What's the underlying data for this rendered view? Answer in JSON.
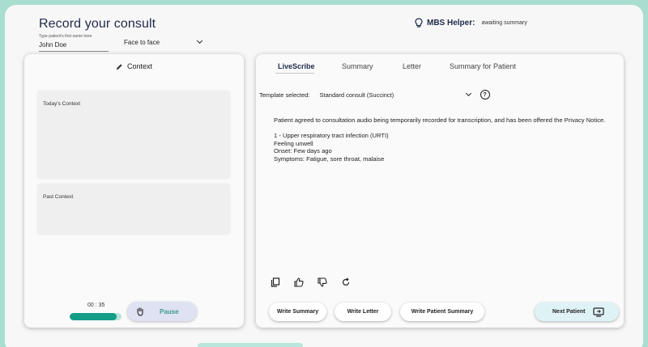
{
  "header": {
    "title": "Record your consult",
    "patient_label": "Type patient's first name here",
    "patient_name": "John Doe",
    "consult_mode": "Face to face"
  },
  "mbs": {
    "label": "MBS Helper:",
    "status": "awaiting summary",
    "icon": "lightbulb-icon"
  },
  "context": {
    "heading": "Context",
    "today_label": "Today's Context",
    "past_label": "Past Context"
  },
  "recording": {
    "timer": "00 : 35",
    "progress_fraction": 0.9,
    "pause_label": "Pause"
  },
  "tabs": [
    "LiveScribe",
    "Summary",
    "Letter",
    "Summary for Patient"
  ],
  "template": {
    "label": "Template selected:",
    "value": "Standard consult (Succinct)"
  },
  "note": {
    "consent": "Patient agreed to consultation audio being temporarily recorded for transcription, and has been offered the Privacy Notice.",
    "lines": [
      "1 - Upper respiratory tract infection (URTI)",
      "Feeling unwell",
      "Onset: Few days ago",
      "Symptoms: Fatigue, sore throat, malaise"
    ]
  },
  "actions": {
    "write_summary": "Write Summary",
    "write_letter": "Write Letter",
    "write_patient_summary": "Write Patient Summary",
    "next_patient": "Next Patient"
  },
  "colors": {
    "accent_teal": "#139c88",
    "background": "#a9ddd0",
    "title_navy": "#1e2a4a"
  }
}
